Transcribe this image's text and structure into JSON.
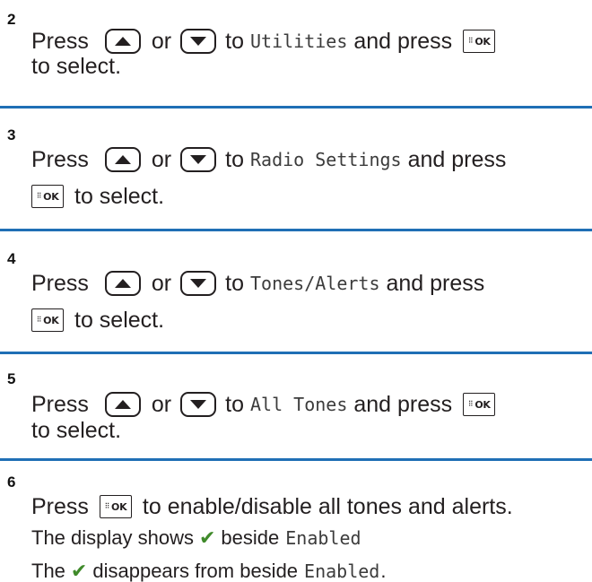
{
  "steps": [
    {
      "number": "2",
      "press": "Press",
      "or": "or",
      "to": "to",
      "target": "Utilities",
      "and_press": "and press",
      "select": "to select."
    },
    {
      "number": "3",
      "press": "Press",
      "or": "or",
      "to": "to",
      "target": "Radio Settings",
      "and_press": "and press",
      "select": "to select."
    },
    {
      "number": "4",
      "press": "Press",
      "or": "or",
      "to": "to",
      "target": "Tones/Alerts",
      "and_press": "and press",
      "select": "to select."
    },
    {
      "number": "5",
      "press": "Press",
      "or": "or",
      "to": "to",
      "target": "All Tones",
      "and_press": "and press",
      "select": "to select."
    },
    {
      "number": "6",
      "press": "Press",
      "action": "to enable/disable all tones and alerts.",
      "result1_a": "The display shows",
      "result1_b": "beside",
      "result1_value": "Enabled",
      "result2_a": "The",
      "result2_b": "disappears from beside",
      "result2_value": "Enabled",
      "result2_end": "."
    }
  ],
  "keys": {
    "ok_label": "OK",
    "ok_grid": "⠿",
    "up_icon": "up-arrow-icon",
    "down_icon": "down-arrow-icon"
  },
  "colors": {
    "divider": "#1f6fb5",
    "check": "#3f8a2a"
  }
}
